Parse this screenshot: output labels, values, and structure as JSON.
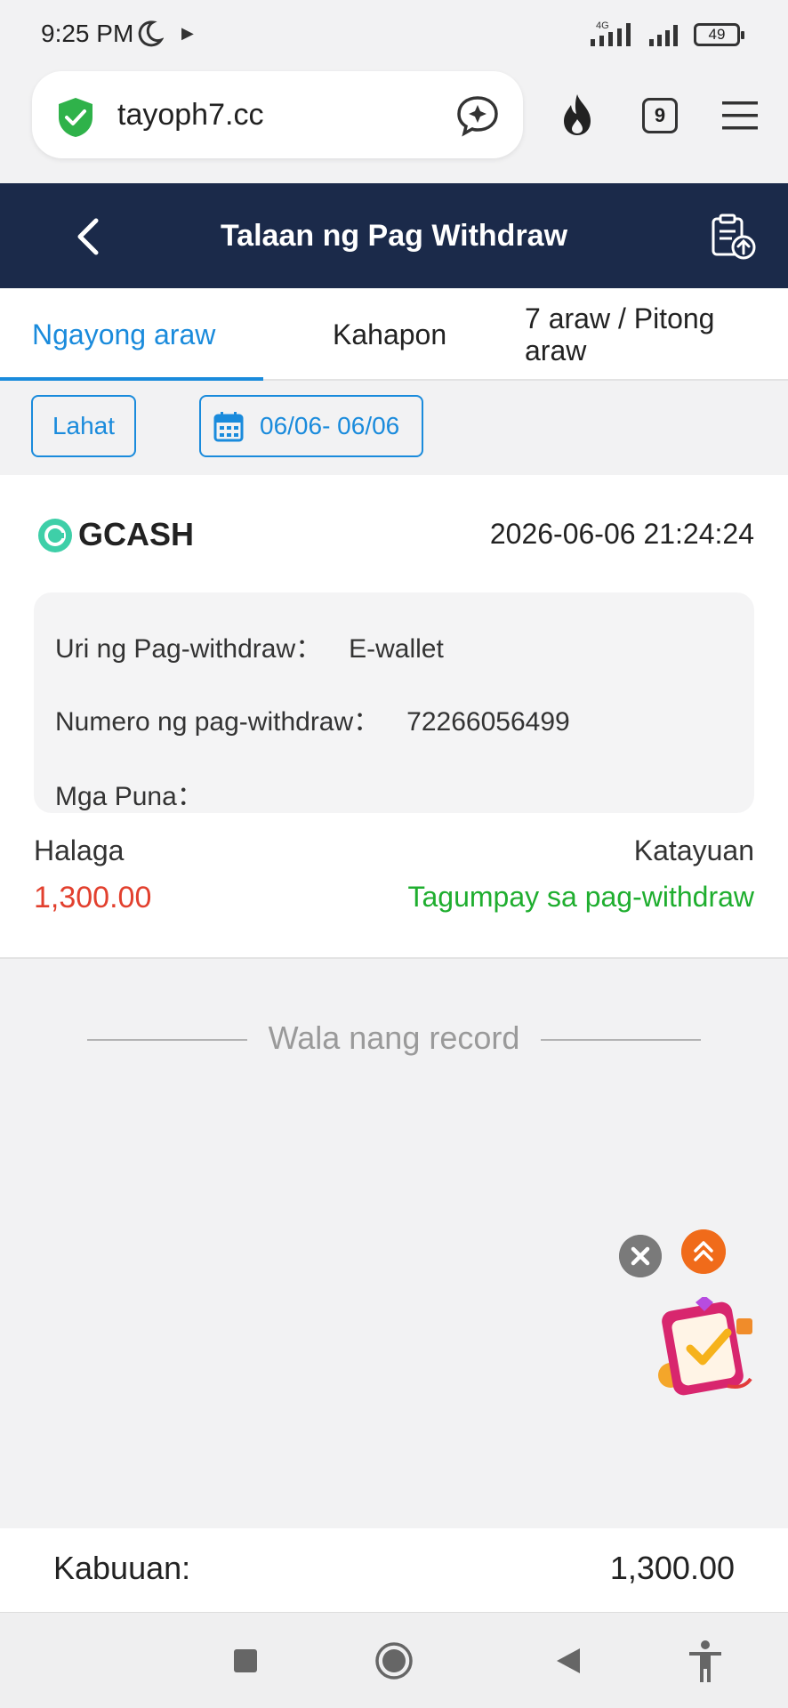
{
  "status_bar": {
    "time": "9:25 PM",
    "network": "4G",
    "battery": "49"
  },
  "browser": {
    "url": "tayoph7.cc",
    "tab_count": "9"
  },
  "header": {
    "title": "Talaan ng Pag Withdraw"
  },
  "tabs": [
    {
      "label": "Ngayong araw",
      "active": true
    },
    {
      "label": "Kahapon",
      "active": false
    },
    {
      "label": "7 araw / Pitong araw",
      "active": false
    }
  ],
  "filters": {
    "all_label": "Lahat",
    "date_range": "06/06- 06/06"
  },
  "record": {
    "provider": "GCASH",
    "datetime": "2026-06-06 21:24:24",
    "type_label": "Uri ng Pag-withdraw：",
    "type_value": "E-wallet",
    "number_label": "Numero ng pag-withdraw：",
    "number_value": "72266056499",
    "remarks_label": "Mga Puna：",
    "remarks_value": "",
    "amount_label": "Halaga",
    "amount_value": "1,300.00",
    "status_label": "Katayuan",
    "status_value": "Tagumpay sa pag-withdraw"
  },
  "empty_text": "Wala nang record",
  "footer": {
    "total_label": "Kabuuan:",
    "total_value": "1,300.00"
  },
  "colors": {
    "accent": "#1a8bdc",
    "header_bg": "#1b2a4a",
    "amount": "#e2402e",
    "success": "#1fae2f"
  }
}
